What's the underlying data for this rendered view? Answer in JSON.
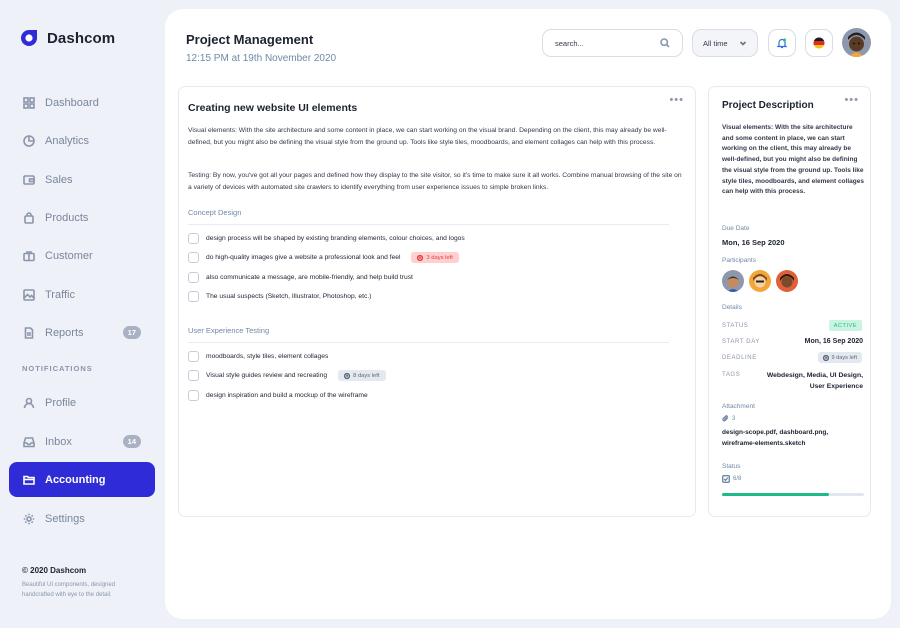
{
  "brand": {
    "name": "Dashcom",
    "color": "#2f2bd6"
  },
  "nav": {
    "items": [
      {
        "label": "Dashboard",
        "icon": "grid-icon"
      },
      {
        "label": "Analytics",
        "icon": "pie-chart-icon"
      },
      {
        "label": "Sales",
        "icon": "wallet-icon"
      },
      {
        "label": "Products",
        "icon": "bag-icon"
      },
      {
        "label": "Customer",
        "icon": "briefcase-icon"
      },
      {
        "label": "Traffic",
        "icon": "image-icon"
      },
      {
        "label": "Reports",
        "icon": "document-icon",
        "badge": "17"
      }
    ],
    "section_label": "NOTIFICATIONS",
    "items2": [
      {
        "label": "Profile",
        "icon": "user-icon"
      },
      {
        "label": "Inbox",
        "icon": "inbox-icon",
        "badge": "14"
      },
      {
        "label": "Accounting",
        "icon": "folder-icon",
        "active": true
      },
      {
        "label": "Settings",
        "icon": "gear-icon"
      }
    ],
    "active_color": "#2f2bd6"
  },
  "footer": {
    "title": "© 2020 Dashcom",
    "desc": "Beautiful UI components, designed handcrafted with eye to the detail."
  },
  "header": {
    "title": "Project Management",
    "subtitle": "12:15 PM at 19th November 2020",
    "search_placeholder": "search...",
    "filter_value": "All time"
  },
  "task": {
    "title": "Creating new website UI elements",
    "p1": "Visual elements: With the site architecture and some content in place, we can start working on the visual brand. Depending on the client, this may already be well-defined, but you might also be defining the visual style from the ground up. Tools like style tiles, moodboards, and element collages can help with this process.",
    "p2": "Testing: By now, you've got all your pages and defined how they display to the site visitor, so it's time to make sure it all works. Combine manual browsing of the site on a variety of devices with automated site crawlers to identify everything from user experience issues to simple broken links.",
    "section1": {
      "label": "Concept Design",
      "items": [
        {
          "text": "design process will  be shaped by existing branding elements, colour choices, and logos"
        },
        {
          "text": "do high-quality images give a website a professional look and feel",
          "tag": "3 days left",
          "tag_style": "red"
        },
        {
          "text": "also communicate a message, are mobile-friendly, and help build trust"
        },
        {
          "text": "The usual suspects (Sketch, Illustrator, Photoshop, etc.)"
        }
      ]
    },
    "section2": {
      "label": "User Experience Testing",
      "items": [
        {
          "text": "moodboards, style tiles, element collages"
        },
        {
          "text": "Visual style guides review and recreating",
          "tag": "8 days left",
          "tag_style": "gray"
        },
        {
          "text": "design inspiration and build a mockup of the wireframe"
        }
      ]
    }
  },
  "desc": {
    "title": "Project Description",
    "text": "Visual elements: With the site architecture and some content in place, we can start working on the client, this may already be well-defined, but you might also be defining the visual style from the ground up. Tools like style tiles, moodboards, and element collages can help with this process.",
    "due_label": "Due Date",
    "due_value": "Mon, 16 Sep 2020",
    "participants_label": "Participants",
    "details_label": "Details",
    "status_key": "STATUS",
    "status_value": "ACTIVE",
    "start_key": "START DAY",
    "start_value": "Mon, 16 Sep 2020",
    "deadline_key": "DEADLINE",
    "deadline_value": "9 days left",
    "tags_key": "TAGS",
    "tags_value": "Webdesign, Media, UI Design, User Experience",
    "attachment_label": "Attachment",
    "attachment_count": "3",
    "attachment_files": "design-scope.pdf, dashboard.png, wireframe-elements.sketch",
    "status_label": "Status",
    "status_progress": "6/8",
    "progress_fraction": 0.75,
    "progress_color": "#1fb98a"
  }
}
